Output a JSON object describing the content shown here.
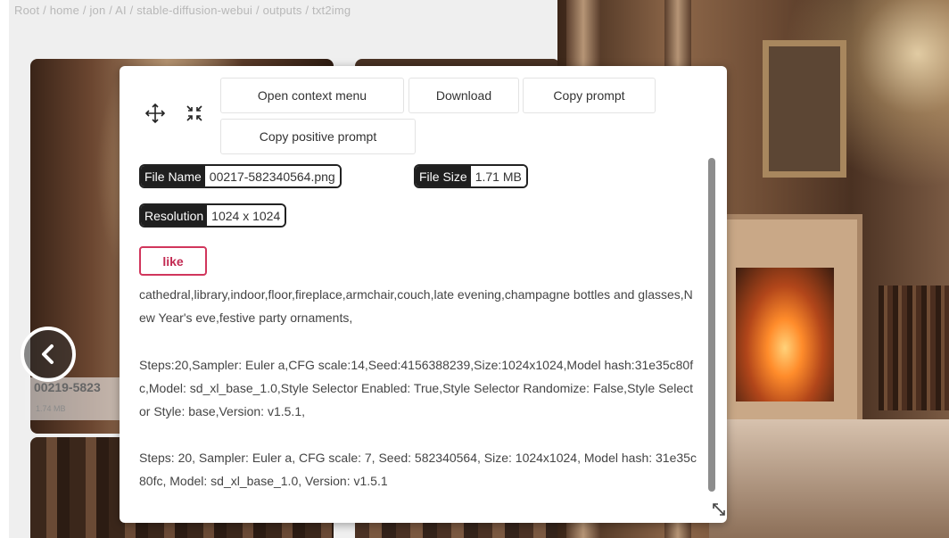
{
  "breadcrumb": "Root  /  home  /  jon  /  AI  /  stable-diffusion-webui  /  outputs  /  txt2img",
  "gallery": {
    "thumb_name": "00219-5823",
    "thumb_size": "1.74 MB"
  },
  "modal": {
    "buttons": {
      "open_context_menu": "Open context menu",
      "download": "Download",
      "copy_prompt": "Copy prompt",
      "copy_positive_prompt": "Copy positive prompt"
    },
    "tags": {
      "file_name_label": "File Name",
      "file_name_value": "00217-582340564.png",
      "file_size_label": "File Size",
      "file_size_value": "1.71 MB",
      "resolution_label": "Resolution",
      "resolution_value": "1024 x 1024"
    },
    "like_label": "like",
    "prompt_text": "cathedral,library,indoor,floor,fireplace,armchair,couch,late evening,champagne bottles and glasses,New Year's eve,festive party ornaments,",
    "params_text_1": "Steps:20,Sampler: Euler a,CFG scale:14,Seed:4156388239,Size:1024x1024,Model hash:31e35c80fc,Model: sd_xl_base_1.0,Style Selector Enabled: True,Style Selector Randomize: False,Style Selector Style: base,Version: v1.5.1,",
    "params_text_2": "Steps: 20, Sampler: Euler a, CFG scale: 7, Seed: 582340564, Size: 1024x1024, Model hash: 31e35c80fc, Model: sd_xl_base_1.0, Version: v1.5.1"
  },
  "colors": {
    "like_accent": "#c22a52",
    "tag_dark": "#1f1f1f"
  },
  "icons": {
    "move": "move-arrows-icon",
    "collapse": "collapse-icon",
    "back": "chevron-left-icon",
    "resize": "resize-handle-icon"
  }
}
